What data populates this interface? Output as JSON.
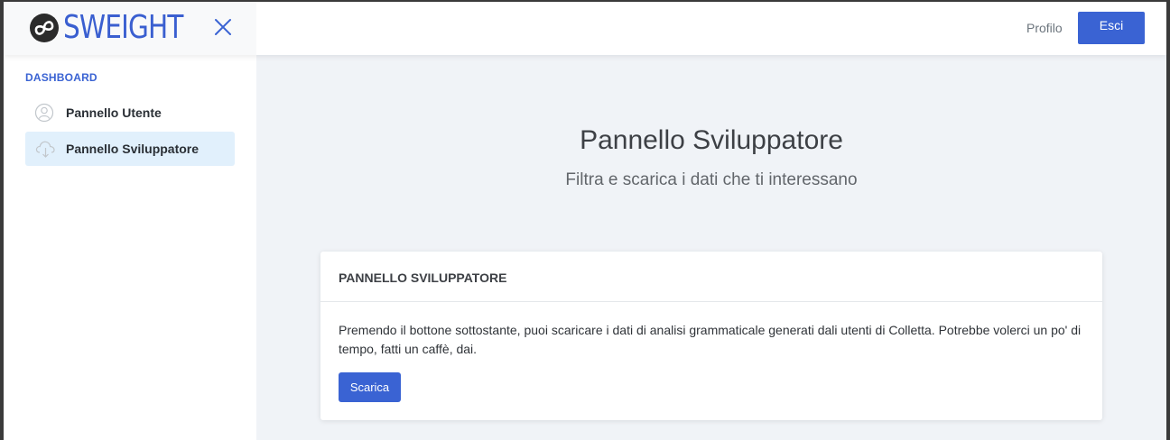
{
  "header": {
    "logo_text": "SWEIGHT",
    "profile_label": "Profilo",
    "logout_label": "Esci"
  },
  "sidebar": {
    "heading": "DASHBOARD",
    "items": [
      {
        "label": "Pannello Utente",
        "icon": "user-icon",
        "active": false
      },
      {
        "label": "Pannello Sviluppatore",
        "icon": "cloud-download-icon",
        "active": true
      }
    ]
  },
  "main": {
    "title": "Pannello Sviluppatore",
    "subtitle": "Filtra e scarica i dati che ti interessano",
    "card": {
      "title": "PANNELLO SVILUPPATORE",
      "text": "Premendo il bottone sottostante, puoi scaricare i dati di analisi grammaticale generati dali utenti di Colletta. Potrebbe volerci un po' di tempo, fatti un caffè, dai.",
      "button_label": "Scarica"
    }
  },
  "colors": {
    "accent": "#3a63d3",
    "active_item_bg": "#e1f0fc",
    "page_bg": "#f0f3f7"
  }
}
